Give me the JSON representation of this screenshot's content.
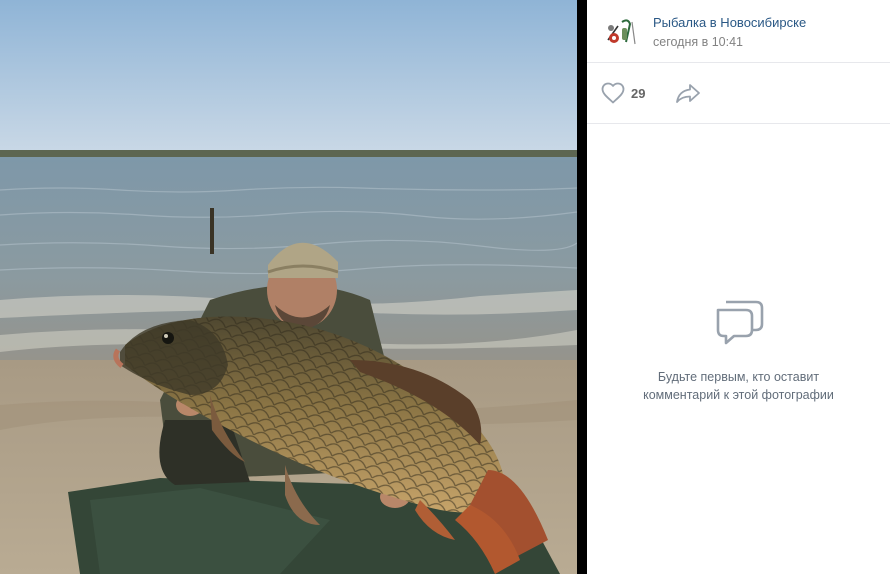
{
  "photo": {
    "description_icon": "fish-photo"
  },
  "post": {
    "author": "Рыбалка в Новосибирске",
    "date": "сегодня в 10:41",
    "avatar_icon": "fishing-avatar-icon"
  },
  "actions": {
    "like_icon": "heart-icon",
    "like_count": "29",
    "share_icon": "share-icon"
  },
  "comments": {
    "empty_icon": "comments-icon",
    "empty_line1": "Будьте первым, кто оставит",
    "empty_line2": "комментарий к этой фотографии"
  },
  "colors": {
    "link": "#2a5885",
    "muted": "#828282",
    "divider": "#e7e8ec",
    "icon": "#99a2ad"
  }
}
